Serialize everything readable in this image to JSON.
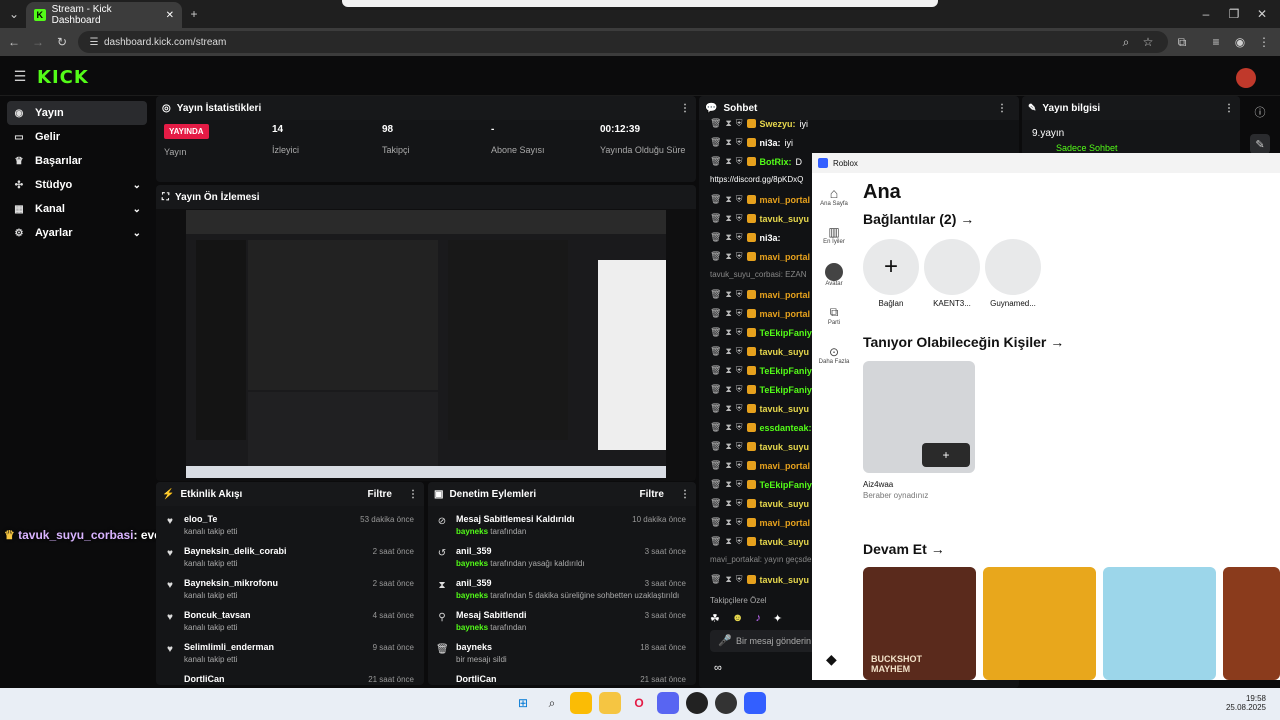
{
  "browser": {
    "tab_title": "Stream - Kick Dashboard",
    "url": "dashboard.kick.com/stream"
  },
  "brand": {
    "logo": "KICK",
    "accent": "#53fc18"
  },
  "sidebar": {
    "items": [
      {
        "label": "Yayın",
        "icon": "broadcast-icon",
        "active": true
      },
      {
        "label": "Gelir",
        "icon": "money-icon"
      },
      {
        "label": "Başarılar",
        "icon": "trophy-icon"
      },
      {
        "label": "Stüdyo",
        "icon": "studio-icon",
        "expand": true
      },
      {
        "label": "Kanal",
        "icon": "channel-icon",
        "expand": true
      },
      {
        "label": "Ayarlar",
        "icon": "gear-icon",
        "expand": true
      }
    ]
  },
  "stats": {
    "title": "Yayın İstatistikleri",
    "live_badge": "YAYINDA",
    "items": [
      {
        "value": "",
        "label": "Yayın"
      },
      {
        "value": "14",
        "label": "İzleyici"
      },
      {
        "value": "98",
        "label": "Takipçi"
      },
      {
        "value": "-",
        "label": "Abone Sayısı"
      },
      {
        "value": "00:12:39",
        "label": "Yayında Olduğu Süre"
      }
    ]
  },
  "preview": {
    "title": "Yayın Ön İzlemesi"
  },
  "activity": {
    "title": "Etkinlik Akışı",
    "filter": "Filtre",
    "rows": [
      {
        "name": "eloo_Te",
        "sub": "kanalı takip etti",
        "time": "53 dakika önce"
      },
      {
        "name": "Bayneksin_delik_corabi",
        "sub": "kanalı takip etti",
        "time": "2 saat önce"
      },
      {
        "name": "Bayneksin_mikrofonu",
        "sub": "kanalı takip etti",
        "time": "2 saat önce"
      },
      {
        "name": "Boncuk_tavsan",
        "sub": "kanalı takip etti",
        "time": "4 saat önce"
      },
      {
        "name": "Selimlimli_enderman",
        "sub": "kanalı takip etti",
        "time": "9 saat önce"
      },
      {
        "name": "DortliCan",
        "sub": "",
        "time": "21 saat önce"
      }
    ]
  },
  "moderation": {
    "title": "Denetim Eylemleri",
    "filter": "Filtre",
    "rows": [
      {
        "name": "Mesaj Sabitlemesi Kaldırıldı",
        "by": "bayneks",
        "sub": "tarafından",
        "time": "10 dakika önce",
        "icon": "unpin-icon"
      },
      {
        "name": "anil_359",
        "by": "bayneks",
        "sub": "tarafından yasağı kaldırıldı",
        "time": "3 saat önce",
        "icon": "unban-icon"
      },
      {
        "name": "anil_359",
        "by": "bayneks",
        "sub": "tarafından 5 dakika süreliğine sohbetten uzaklaştırıldı",
        "time": "3 saat önce",
        "icon": "timeout-icon"
      },
      {
        "name": "Mesaj Sabitlendi",
        "by": "bayneks",
        "sub": "tarafından",
        "time": "3 saat önce",
        "icon": "pin-icon"
      },
      {
        "name": "bayneks",
        "by": "",
        "sub": "bir mesajı sildi",
        "time": "18 saat önce",
        "icon": "trash-icon"
      },
      {
        "name": "DortliCan",
        "by": "",
        "sub": "",
        "time": "21 saat önce",
        "icon": "user-icon"
      }
    ]
  },
  "overlay_chat": {
    "user": "tavuk_suyu_corbasi",
    "message": ": evet baya geriden hatta"
  },
  "chat": {
    "title": "Sohbet",
    "lines": [
      {
        "user": "Swezyu:",
        "text": "iyi",
        "color": "#e6d74d"
      },
      {
        "user": "ni3a:",
        "text": "iyi",
        "color": "#fff"
      },
      {
        "user": "BotRix:",
        "text": "D",
        "color": "#53fc18"
      },
      {
        "user": "",
        "text": "https://discord.gg/8pKDxQ",
        "color": "#fff"
      },
      {
        "user": "mavi_portal",
        "text": "",
        "color": "#e6a11d"
      },
      {
        "user": "tavuk_suyu",
        "text": "",
        "color": "#e6d74d"
      },
      {
        "user": "ni3a:",
        "text": "",
        "color": "#fff"
      },
      {
        "user": "mavi_portal",
        "text": "",
        "color": "#e6a11d"
      },
      {
        "user": "",
        "text": "tavuk_suyu_corbasi: EZAN",
        "color": "#888"
      },
      {
        "user": "mavi_portal",
        "text": "",
        "color": "#e6a11d"
      },
      {
        "user": "mavi_portal",
        "text": "",
        "color": "#e6a11d"
      },
      {
        "user": "TeEkipFaniyim_",
        "text": "",
        "color": "#53fc18"
      },
      {
        "user": "tavuk_suyu",
        "text": "",
        "color": "#e6d74d"
      },
      {
        "user": "TeEkipFaniyim",
        "text": "",
        "color": "#53fc18"
      },
      {
        "user": "TeEkipFaniyim",
        "text": "",
        "color": "#53fc18"
      },
      {
        "user": "tavuk_suyu",
        "text": "",
        "color": "#e6d74d"
      },
      {
        "user": "essdanteak:",
        "text": "mo",
        "color": "#53fc18"
      },
      {
        "user": "tavuk_suyu",
        "text": "",
        "color": "#e6d74d"
      },
      {
        "user": "mavi_portal",
        "text": "",
        "color": "#e6a11d"
      },
      {
        "user": "TeEkipFaniyim",
        "text": "",
        "color": "#53fc18"
      },
      {
        "user": "tavuk_suyu",
        "text": "",
        "color": "#e6d74d"
      },
      {
        "user": "mavi_portal",
        "text": "",
        "color": "#e6a11d"
      },
      {
        "user": "tavuk_suyu",
        "text": "",
        "color": "#e6d74d"
      },
      {
        "user": "",
        "text": "mavi_portakal: yayın geçsde",
        "color": "#888"
      },
      {
        "user": "tavuk_suyu",
        "text": "",
        "color": "#e6d74d"
      }
    ],
    "followers_label": "Takipçilere Özel",
    "input_placeholder": "Bir mesaj gönderin"
  },
  "info": {
    "title": "Yayın bilgisi",
    "stream_title": "9.yayın",
    "tag": "Sadece Sohbet"
  },
  "roblox": {
    "window_title": "Roblox",
    "heading": "Ana",
    "connections": "Bağlantılar (2) →",
    "friends": [
      "Bağlan",
      "KAENT3...",
      "Guynamed..."
    ],
    "maybe_know": "Tanıyor Olabileceğin Kişiler →",
    "suggest_name": "Aiz4waa",
    "suggest_sub": "Beraber oynadınız",
    "continue": "Devam Et →",
    "nav": [
      "Ana Sayfa",
      "En İyiler",
      "Avatar",
      "Parti",
      "Daha Fazla"
    ],
    "game_label": "BUCKSHOT MAYHEM"
  },
  "taskbar": {
    "time": "19:58",
    "date": "25.08.2025"
  }
}
